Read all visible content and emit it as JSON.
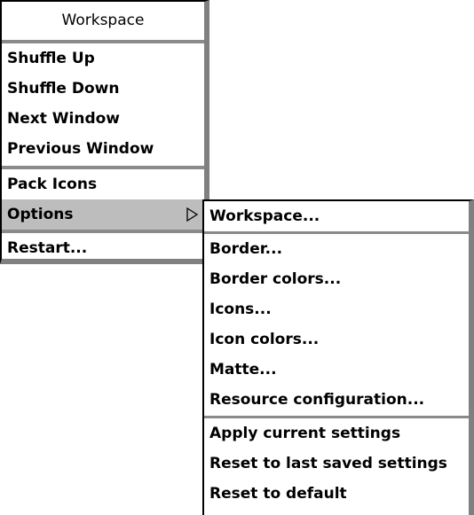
{
  "main_menu": {
    "title": "Workspace",
    "items": [
      {
        "label": "Shuffle Up"
      },
      {
        "label": "Shuffle Down"
      },
      {
        "label": "Next Window"
      },
      {
        "label": "Previous Window"
      },
      {
        "label": "Pack Icons"
      },
      {
        "label": "Options",
        "submenu_icon": "submenu-arrow-icon"
      },
      {
        "label": "Restart..."
      }
    ]
  },
  "options_submenu": {
    "items": [
      {
        "label": "Workspace..."
      },
      {
        "label": "Border..."
      },
      {
        "label": "Border colors..."
      },
      {
        "label": "Icons..."
      },
      {
        "label": "Icon colors..."
      },
      {
        "label": "Matte..."
      },
      {
        "label": "Resource configuration..."
      },
      {
        "label": "Apply current settings"
      },
      {
        "label": "Reset to last saved settings"
      },
      {
        "label": "Reset to default"
      }
    ]
  }
}
